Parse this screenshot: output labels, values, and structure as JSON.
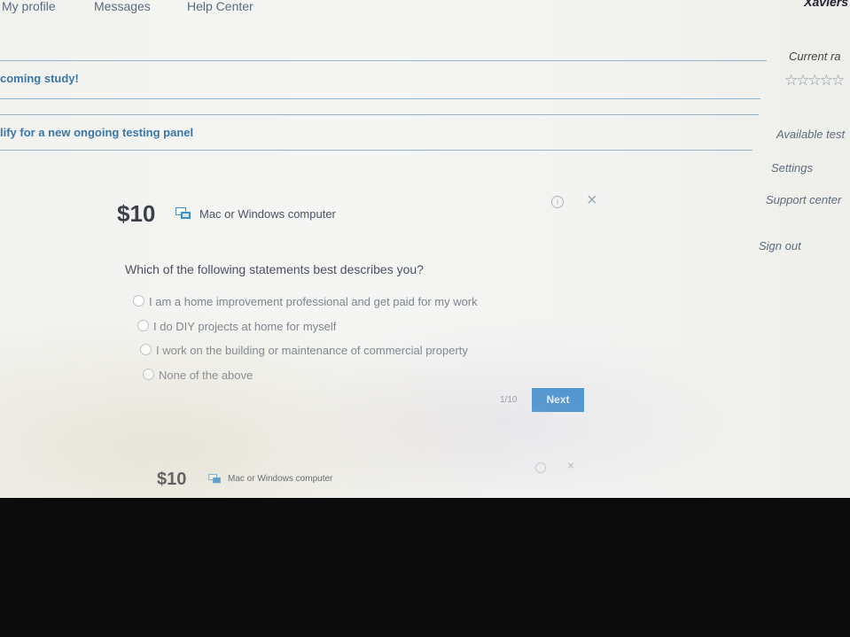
{
  "nav": {
    "my_profile": "My profile",
    "messages": "Messages",
    "help_center": "Help Center",
    "username": "Xaviers"
  },
  "studies": [
    {
      "label": "coming study!"
    },
    {
      "label": "lify for a new ongoing testing panel"
    }
  ],
  "sidebar": {
    "rating_title": "Current ra",
    "rating_stars": "☆☆☆☆☆",
    "available_tests": "Available test",
    "settings": "Settings",
    "support_center": "Support center",
    "sign_out": "Sign out"
  },
  "test_card": {
    "price": "$10",
    "device": "Mac or Windows computer",
    "question": "Which of the following statements best describes you?",
    "options": [
      "I am a home improvement professional and get paid for my work",
      "I do DIY projects at home for myself",
      "I work on the building or maintenance of commercial property",
      "None of the above"
    ],
    "pager": "1/10",
    "next_label": "Next",
    "info_glyph": "i",
    "close_glyph": "×"
  },
  "test_card_2": {
    "price": "$10",
    "device": "Mac or Windows computer",
    "close_glyph": "×"
  },
  "colors": {
    "accent": "#3f90cf",
    "link": "#3a76a6",
    "rule": "#93b6cf"
  }
}
